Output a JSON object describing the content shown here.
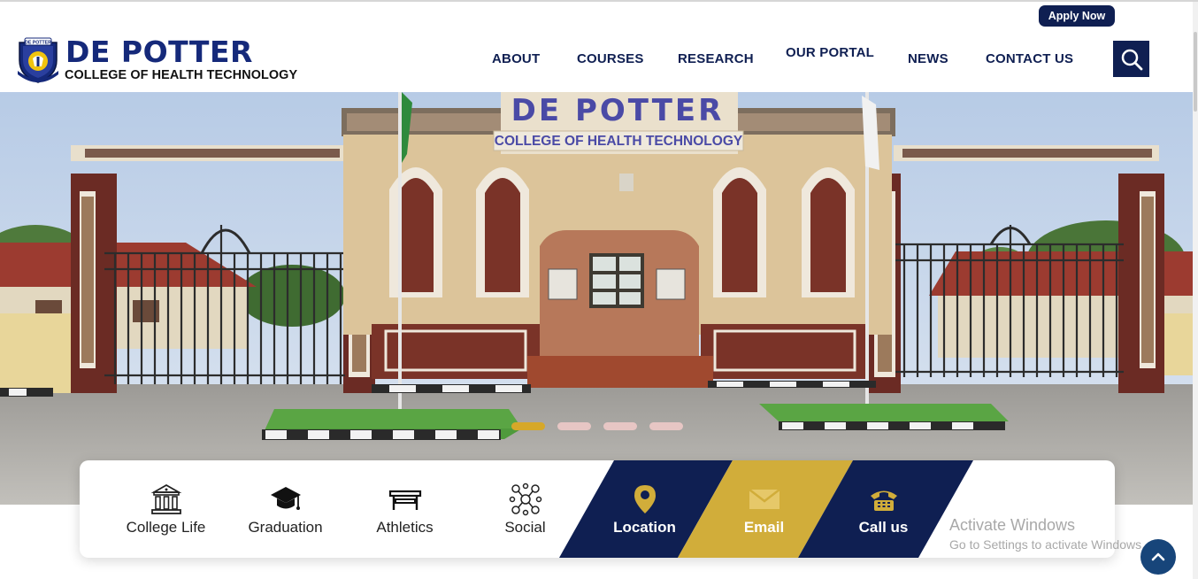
{
  "header": {
    "apply_label": "Apply Now",
    "brand_name": "DE POTTER",
    "brand_sub": "COLLEGE OF HEALTH TECHNOLOGY",
    "crest_text": "DE POTTER"
  },
  "nav": {
    "items": [
      {
        "label": "ABOUT"
      },
      {
        "label": "COURSES"
      },
      {
        "label": "RESEARCH"
      },
      {
        "label": "OUR PORTAL"
      },
      {
        "label": "NEWS"
      },
      {
        "label": "CONTACT US"
      }
    ],
    "search_icon": "search-icon"
  },
  "hero": {
    "sign_title": "DE POTTER",
    "sign_subtitle": "COLLEGE OF HEALTH TECHNOLOGY",
    "slide_count": 4,
    "active_slide": 1
  },
  "quick_links": {
    "items": [
      {
        "label": "College Life",
        "icon": "building-icon"
      },
      {
        "label": "Graduation",
        "icon": "graduation-cap-icon"
      },
      {
        "label": "Athletics",
        "icon": "bench-icon"
      },
      {
        "label": "Social",
        "icon": "network-icon"
      }
    ],
    "contacts": [
      {
        "label": "Location",
        "icon": "map-pin-icon",
        "color": "#0f1f52"
      },
      {
        "label": "Email",
        "icon": "envelope-icon",
        "color": "#d1ad3a"
      },
      {
        "label": "Call us",
        "icon": "phone-icon",
        "color": "#0f1f52"
      }
    ]
  },
  "system": {
    "activate_title": "Activate Windows",
    "activate_sub": "Go to Settings to activate Windows."
  },
  "colors": {
    "navy": "#0f1f52",
    "gold": "#d1ad3a",
    "brand_blue": "#15297a"
  }
}
